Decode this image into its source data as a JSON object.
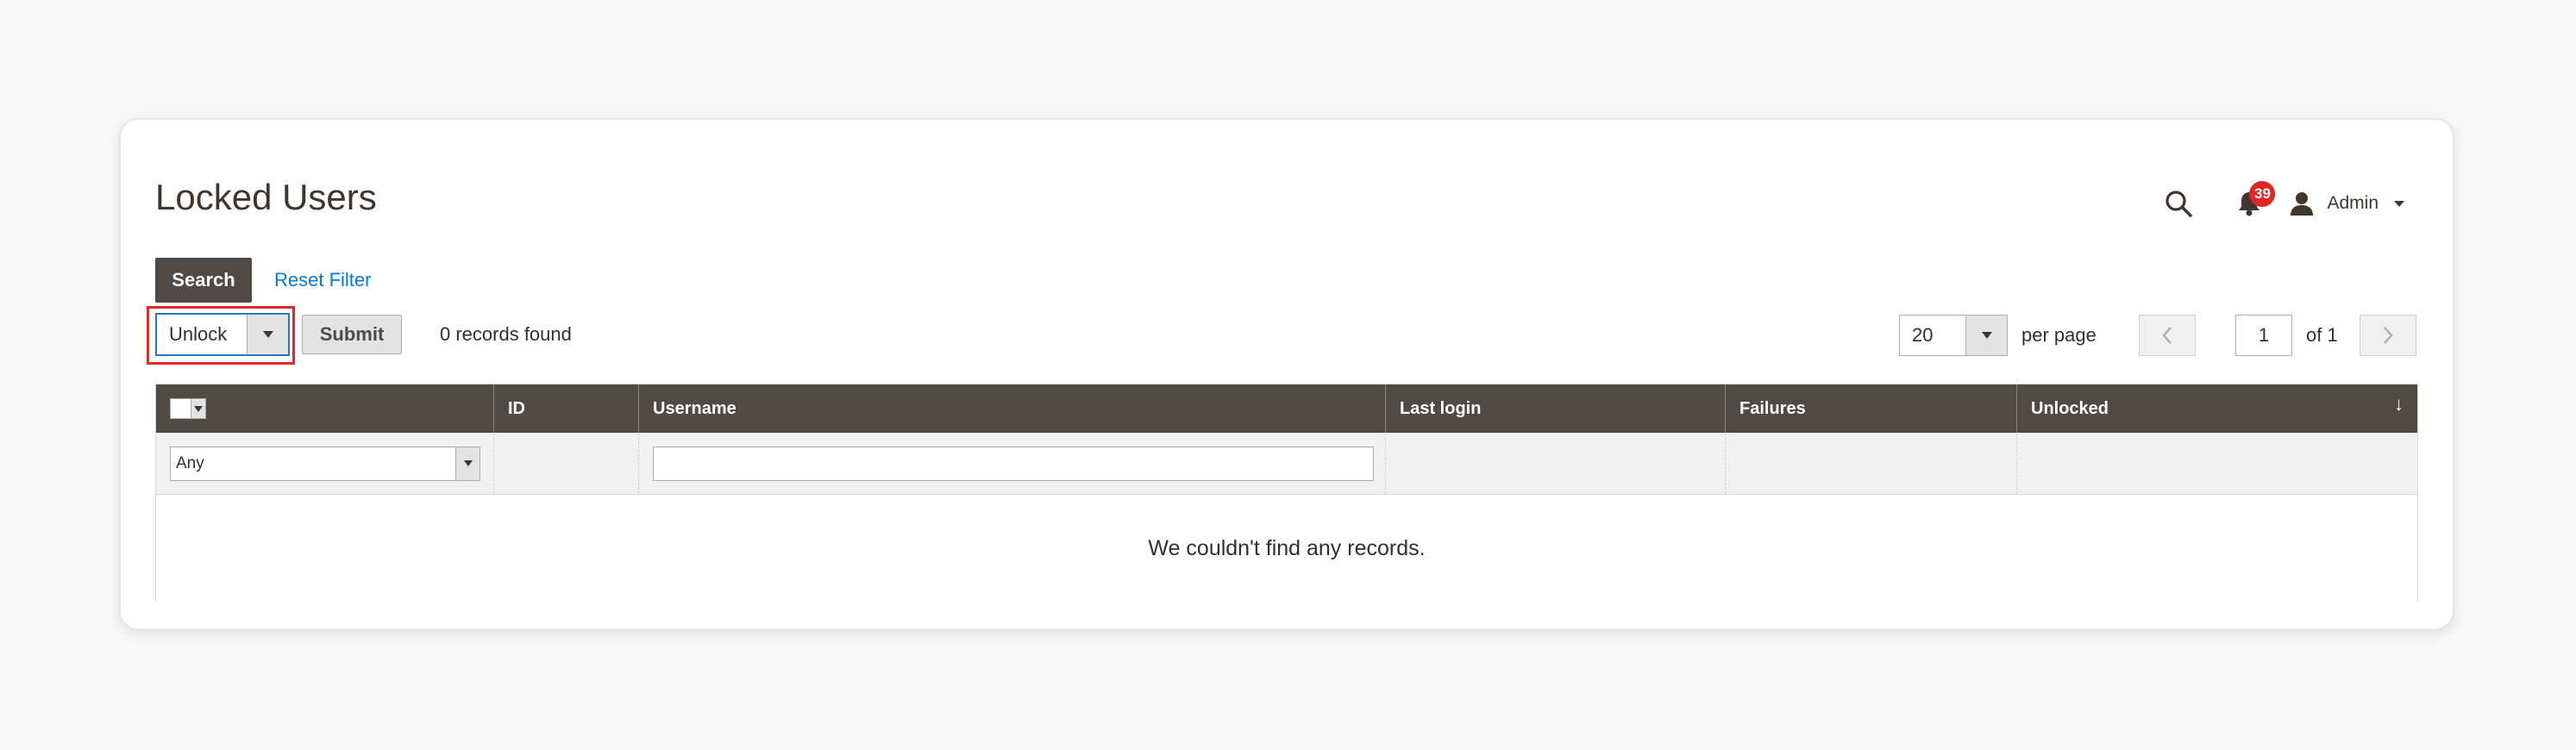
{
  "page": {
    "title": "Locked Users"
  },
  "header": {
    "notifications_count": "39",
    "user_name": "Admin",
    "icons": [
      "search-icon",
      "bell-icon",
      "user-icon",
      "chevron-down-icon"
    ]
  },
  "filters": {
    "search_label": "Search",
    "reset_label": "Reset Filter"
  },
  "massaction": {
    "selected": "Unlock",
    "submit_label": "Submit",
    "records_found": "0 records found"
  },
  "pager": {
    "per_page_value": "20",
    "per_page_label": "per page",
    "current_page": "1",
    "of_label": "of 1"
  },
  "grid": {
    "columns": [
      "ID",
      "Username",
      "Last login",
      "Failures",
      "Unlocked"
    ],
    "sort_indicator": "↓",
    "filter_any": "Any",
    "username_filter_value": "",
    "empty_message": "We couldn't find any records."
  },
  "colors": {
    "header_bg": "#514943",
    "link": "#007bdb",
    "badge": "#e22626",
    "highlight": "#e02b27"
  }
}
